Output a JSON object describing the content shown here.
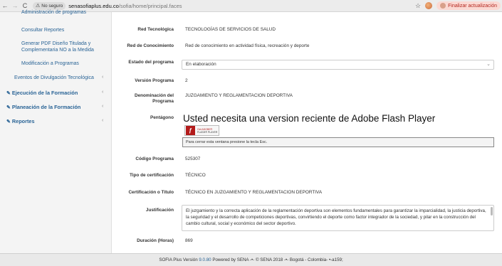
{
  "browser": {
    "back_label": "←",
    "forward_label": "→",
    "reload_label": "C",
    "security_label": "No seguro",
    "url_host": "senasofiaplus.edu.co",
    "url_path": "/sofia/home/principal.faces",
    "update_label": "Finalizar actualización"
  },
  "sidebar": {
    "cut_item": "Administración de programas",
    "consultar": "Consultar Reportes",
    "pdf_line1": "Generar PDF Diseño Titulada y",
    "pdf_line2": "Complementaria NO a la Medida",
    "modificacion": "Modificación a Programas",
    "eventos": "Eventos de Divulgación Tecnológica",
    "ejecucion": "Ejecución de la Formación",
    "planeacion": "Planeación de la Formación",
    "reportes": "Reportes"
  },
  "form": {
    "red_tec_label": "Red Tecnológica",
    "red_tec_value": "TECNOLOGÍAS DE SERVICIOS DE SALUD",
    "red_con_label": "Red de Conocimiento",
    "red_con_value": "Red de conocimiento en actividad física, recreación y deporte",
    "estado_label": "Estado del programa",
    "estado_value": "En elaboración",
    "version_label": "Versión Programa",
    "version_value": "2",
    "denom_label_1": "Denominación del",
    "denom_label_2": "Programa",
    "denom_value": "JUZGAMIENTO Y REGLAMENTACION DEPORTIVA",
    "pentagono_label": "Pentágono",
    "flash_title": "Usted necesita una version reciente de Adobe Flash Player",
    "flash_badge_top": "Get ADOBE®",
    "flash_badge_bottom": "FLASH® PLAYER",
    "esc_message": "Para cerrar esta ventana presione la tecla Esc.",
    "codigo_label": "Código Programa",
    "codigo_value": "525307",
    "tipo_label": "Tipo de certificación",
    "tipo_value": "TÉCNICO",
    "cert_label": "Certificación o Título",
    "cert_value": "TÉCNICO EN JUZGAMIENTO Y REGLAMENTACION DEPORTIVA",
    "justif_label": "Justificación",
    "justif_value": "El juzgamiento y la correcta aplicación de la reglamentación deportiva son elementos fundamentales para garantizar la imparcialidad, la justicia deportiva, la seguridad y el desarrollo de competiciones deportivas, convirtiendo el deporte como factor integrador de la sociedad, y pilar en la construcción del cambio cultural, social y económico del sector deportivo.",
    "duracion_label": "Duración (Horas)",
    "duracion_value": "869"
  },
  "footer": {
    "prefix": "SOFIA Plus Versión ",
    "version": "9.0.80",
    "suffix": " Powered by SENA -•- © SENA 2018 -•- Bogotá - Colombia- •-a159;"
  }
}
